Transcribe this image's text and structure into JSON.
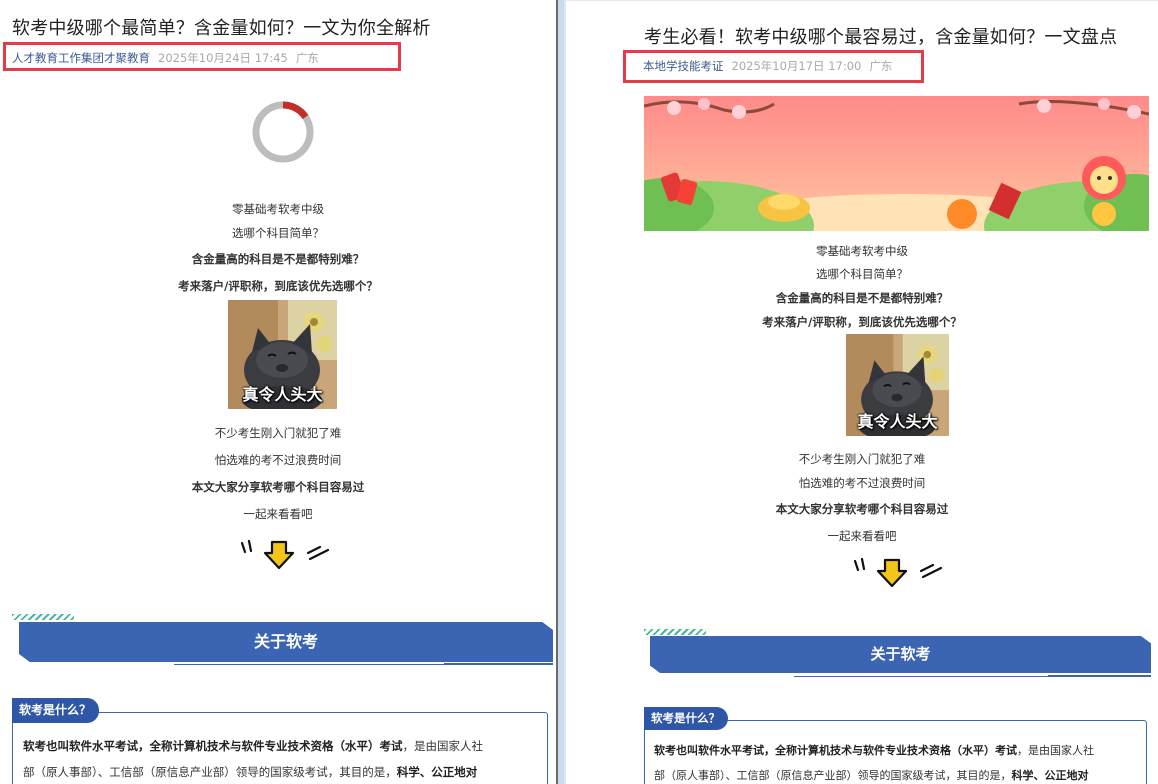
{
  "left": {
    "title": "软考中级哪个最简单？含金量如何？一文为你全解析",
    "source": "人才教育工作集团才聚教育",
    "datetime": "2025年10月24日 17:45",
    "location": "广东",
    "intro_lines": [
      "零基础考软考中级",
      "选哪个科目简单？",
      "含金量高的科目是不是都特别难？",
      "考来落户/评职称，到底该优先选哪个？"
    ],
    "meme_caption": "真令人头大",
    "outro_lines": [
      "不少考生刚入门就犯了难",
      "怕选难的考不过浪费时间",
      "本文大家分享软考哪个科目容易过",
      "一起来看看吧"
    ],
    "section_title": "关于软考",
    "question_tag": "软考是什么？",
    "para_line1_bold": "软考也叫软件水平考试，全称计算机技术与软件专业技术资格（水平）考试",
    "para_line1_rest": "，是由国家人社",
    "para_line2_plain": "部（原人事部）、工信部（原信息产业部）领导的国家级考试，其目的是，",
    "para_line2_bold": "科学、公正地对"
  },
  "right": {
    "title": "考生必看！软考中级哪个最容易过，含金量如何？一文盘点",
    "source": "本地学技能考证",
    "datetime": "2025年10月17日 17:00",
    "location": "广东",
    "intro_lines": [
      "零基础考软考中级",
      "选哪个科目简单？",
      "含金量高的科目是不是都特别难？",
      "考来落户/评职称，到底该优先选哪个？"
    ],
    "meme_caption": "真令人头大",
    "outro_lines": [
      "不少考生刚入门就犯了难",
      "怕选难的考不过浪费时间",
      "本文大家分享软考哪个科目容易过",
      "一起来看看吧"
    ],
    "section_title": "关于软考",
    "question_tag": "软考是什么？",
    "para_line1_bold": "软考也叫软件水平考试，全称计算机技术与软件专业技术资格（水平）考试",
    "para_line1_rest": "，是由国家人社",
    "para_line2_plain": "部（原人事部）、工信部（原信息产业部）领导的国家级考试，其目的是，",
    "para_line2_bold": "科学、公正地对"
  },
  "colors": {
    "accent": "#3b64b2",
    "highlight_box": "#e53a47",
    "source_link": "#3b5c8f",
    "meta_gray": "#a9a9a9"
  },
  "icons": [
    "loading-spinner-icon",
    "down-arrow-icon"
  ]
}
